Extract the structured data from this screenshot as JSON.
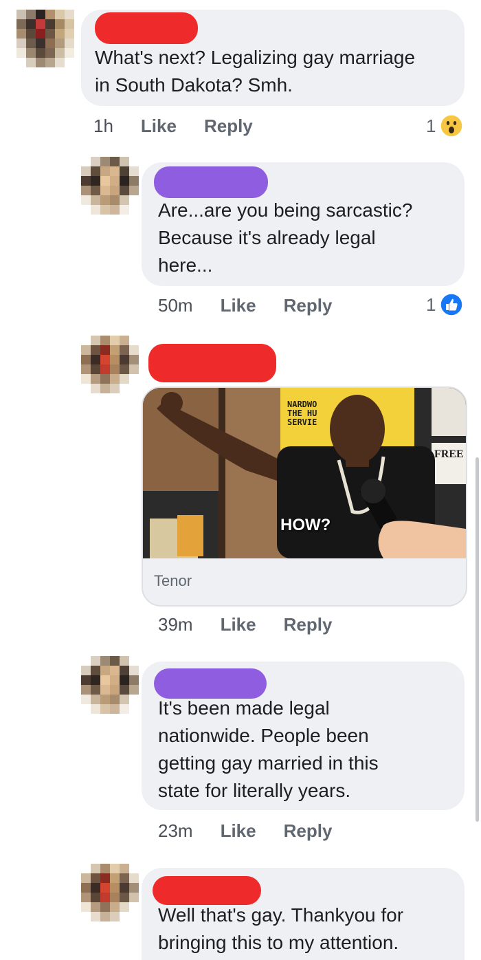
{
  "comments": [
    {
      "text": "What's next? Legalizing gay marriage in South Dakota? Smh.",
      "line1": "What's next? Legalizing gay marriage",
      "line2": "in South Dakota? Smh.",
      "time": "1h",
      "like": "Like",
      "reply": "Reply",
      "reaction_count": "1",
      "reaction": "wow-reaction",
      "redaction_color": "#ee2a2a"
    },
    {
      "line1": "Are...are you being sarcastic?",
      "line2": "Because it's already legal",
      "line3": "here...",
      "time": "50m",
      "like": "Like",
      "reply": "Reply",
      "reaction_count": "1",
      "reaction": "like-reaction",
      "redaction_color": "#8f5ee0"
    },
    {
      "gif_caption": "HOW?",
      "gif_sign1": "NARDWO",
      "gif_sign2": "THE HU",
      "gif_sign3": "SERVIE",
      "gif_poster": "FREE",
      "gif_source": "Tenor",
      "time": "39m",
      "like": "Like",
      "reply": "Reply",
      "redaction_color": "#ee2a2a"
    },
    {
      "line1": "It's been made legal",
      "line2": "nationwide. People been",
      "line3": "getting gay married in this",
      "line4": "state for literally years.",
      "time": "23m",
      "like": "Like",
      "reply": "Reply",
      "redaction_color": "#8f5ee0"
    },
    {
      "line1": "Well that's gay. Thankyou for",
      "line2": "bringing this to my attention.",
      "redaction_color": "#ee2a2a"
    }
  ],
  "colors": {
    "bubble": "#eef0f3",
    "like_blue": "#1877f2",
    "wow_yellow": "#f7c744"
  }
}
